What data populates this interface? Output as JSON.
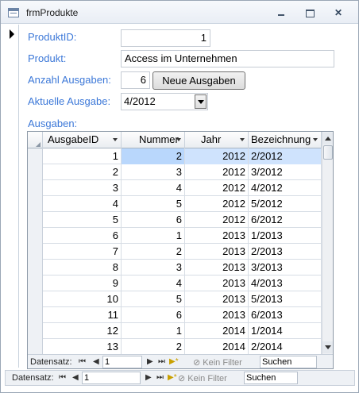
{
  "window": {
    "title": "frmProdukte"
  },
  "form": {
    "produktid_label": "ProduktID:",
    "produktid_value": "1",
    "produkt_label": "Produkt:",
    "produkt_value": "Access im Unternehmen",
    "anzahl_label": "Anzahl Ausgaben:",
    "anzahl_value": "6",
    "neue_button": "Neue Ausgaben",
    "aktuelle_label": "Aktuelle Ausgabe:",
    "aktuelle_value": "4/2012",
    "ausgaben_label": "Ausgaben:"
  },
  "grid": {
    "columns": [
      "AusgabeID",
      "Nummer",
      "Jahr",
      "Bezeichnung"
    ],
    "rows": [
      [
        "1",
        "2",
        "2012",
        "2/2012"
      ],
      [
        "2",
        "3",
        "2012",
        "3/2012"
      ],
      [
        "3",
        "4",
        "2012",
        "4/2012"
      ],
      [
        "4",
        "5",
        "2012",
        "5/2012"
      ],
      [
        "5",
        "6",
        "2012",
        "6/2012"
      ],
      [
        "6",
        "1",
        "2013",
        "1/2013"
      ],
      [
        "7",
        "2",
        "2013",
        "2/2013"
      ],
      [
        "8",
        "3",
        "2013",
        "3/2013"
      ],
      [
        "9",
        "4",
        "2013",
        "4/2013"
      ],
      [
        "10",
        "5",
        "2013",
        "5/2013"
      ],
      [
        "11",
        "6",
        "2013",
        "6/2013"
      ],
      [
        "12",
        "1",
        "2014",
        "1/2014"
      ],
      [
        "13",
        "2",
        "2014",
        "2/2014"
      ]
    ]
  },
  "subnav": {
    "label": "Datensatz:",
    "first": "⏮",
    "prev": "◀",
    "record": "1",
    "next": "▶",
    "last": "⏭",
    "new": "▶*",
    "filter": "Kein Filter",
    "search": "Suchen"
  },
  "mainnav": {
    "label": "Datensatz:",
    "first": "⏮",
    "prev": "◀",
    "record": "1",
    "next": "▶",
    "last": "⏭",
    "new": "▶*",
    "filter": "Kein Filter",
    "search": "Suchen"
  }
}
